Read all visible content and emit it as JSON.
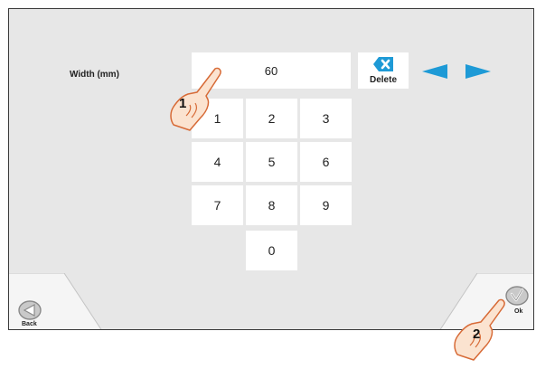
{
  "input": {
    "label": "Width (mm)",
    "value": "60"
  },
  "keypad": {
    "keys": [
      "1",
      "2",
      "3",
      "4",
      "5",
      "6",
      "7",
      "8",
      "9",
      "0"
    ]
  },
  "toolbar": {
    "delete_label": "Delete",
    "left_arrow_icon": "triangle-left-icon",
    "right_arrow_icon": "triangle-right-icon",
    "arrow_color": "#1e9ad6"
  },
  "footer": {
    "back_label": "Back",
    "ok_label": "Ok"
  },
  "callouts": {
    "step1": "1",
    "step2": "2"
  }
}
